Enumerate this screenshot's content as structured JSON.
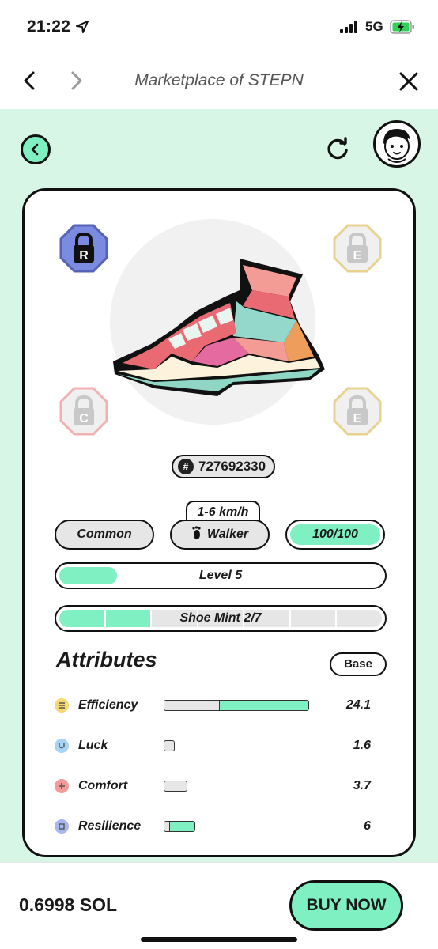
{
  "status_bar": {
    "time": "21:22",
    "network": "5G"
  },
  "browser": {
    "title": "Marketplace of STEPN"
  },
  "sneaker": {
    "token_id": "727692330",
    "speed_range": "1-6 km/h",
    "rarity": "Common",
    "type": "Walker",
    "durability": "100/100",
    "level_label": "Level 5",
    "level_fill": 0.18,
    "mint_label": "Shoe Mint 2/7",
    "mint_done": 2,
    "mint_total": 7,
    "sockets": [
      {
        "letter": "R",
        "active": true,
        "color": "#7b8be0"
      },
      {
        "letter": "E",
        "active": false,
        "color": "#e8d290"
      },
      {
        "letter": "C",
        "active": false,
        "color": "#f1b1b1"
      },
      {
        "letter": "E",
        "active": false,
        "color": "#e8d290"
      }
    ]
  },
  "attributes": {
    "title": "Attributes",
    "toggle_label": "Base",
    "items": [
      {
        "label": "Efficiency",
        "value": "24.1",
        "icon": "efficiency-icon",
        "icon_color": "#f3d970",
        "bar_fill": 0.62
      },
      {
        "label": "Luck",
        "value": "1.6",
        "icon": "luck-icon",
        "icon_color": "#a7d4f5",
        "bar_fill": 0.0
      },
      {
        "label": "Comfort",
        "value": "3.7",
        "icon": "comfort-icon",
        "icon_color": "#f49a9a",
        "bar_fill": 0.0
      },
      {
        "label": "Resilience",
        "value": "6",
        "icon": "resilience-icon",
        "icon_color": "#a9b7ef",
        "bar_fill": 0.85
      }
    ]
  },
  "purchase": {
    "price": "0.6998 SOL",
    "buy_label": "BUY NOW"
  },
  "colors": {
    "accent": "#7ef0c2",
    "background": "#d8f6e6"
  }
}
